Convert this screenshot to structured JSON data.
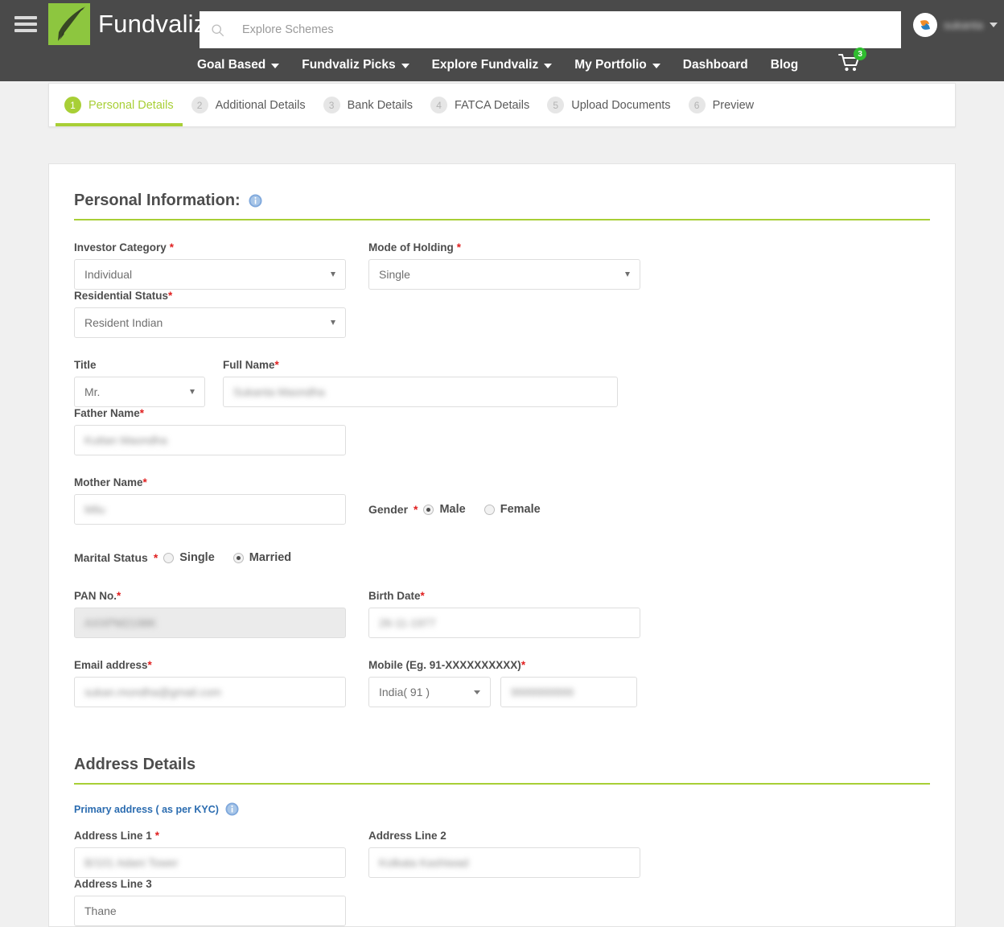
{
  "header": {
    "menu_icon": "hamburger-icon",
    "brand": "Fundvaliz",
    "search": {
      "placeholder": "Explore Schemes",
      "value": "",
      "icon": "search-icon"
    },
    "user": {
      "name": "sukanta",
      "avatar_icon": "user-avatar-icon",
      "caret_icon": "chevron-down-icon"
    }
  },
  "nav": {
    "items": [
      {
        "label": "Goal Based",
        "has_dropdown": true
      },
      {
        "label": "Fundvaliz Picks",
        "has_dropdown": true
      },
      {
        "label": "Explore Fundvaliz",
        "has_dropdown": true
      },
      {
        "label": "My Portfolio",
        "has_dropdown": true
      },
      {
        "label": "Dashboard",
        "has_dropdown": false
      },
      {
        "label": "Blog",
        "has_dropdown": false
      }
    ],
    "cart": {
      "icon": "shopping-cart-icon",
      "badge": "3"
    }
  },
  "wizard": {
    "steps": [
      {
        "num": "1",
        "label": "Personal Details",
        "active": true
      },
      {
        "num": "2",
        "label": "Additional Details",
        "active": false
      },
      {
        "num": "3",
        "label": "Bank Details",
        "active": false
      },
      {
        "num": "4",
        "label": "FATCA Details",
        "active": false
      },
      {
        "num": "5",
        "label": "Upload Documents",
        "active": false
      },
      {
        "num": "6",
        "label": "Preview",
        "active": false
      }
    ]
  },
  "personal": {
    "title": "Personal Information:",
    "info_icon": "info-icon",
    "investor_category": {
      "label": "Investor Category",
      "required": true,
      "value": "Individual"
    },
    "mode_of_holding": {
      "label": "Mode of Holding",
      "required": true,
      "value": "Single"
    },
    "residential_status": {
      "label": "Residential Status",
      "required": true,
      "value": "Resident Indian"
    },
    "title_field": {
      "label": "Title",
      "required": false,
      "value": "Mr."
    },
    "full_name": {
      "label": "Full Name",
      "required": true,
      "value": "Sukanta Maondha",
      "redacted": true
    },
    "father_name": {
      "label": "Father Name",
      "required": true,
      "value": "Kuttan Maondha",
      "redacted": true
    },
    "mother_name": {
      "label": "Mother Name",
      "required": true,
      "value": "Milu",
      "redacted": true
    },
    "gender": {
      "label": "Gender",
      "required": true,
      "selected": "Male",
      "options": [
        {
          "label": "Male",
          "selected": true
        },
        {
          "label": "Female",
          "selected": false
        }
      ]
    },
    "marital_status": {
      "label": "Marital Status",
      "required": true,
      "selected": "Married",
      "options": [
        {
          "label": "Single",
          "selected": false
        },
        {
          "label": "Married",
          "selected": true
        }
      ]
    },
    "pan_no": {
      "label": "PAN No.",
      "required": true,
      "value": "AXXPM2198K",
      "redacted": true,
      "disabled": true
    },
    "birth_date": {
      "label": "Birth Date",
      "required": true,
      "value": "26-11-1977",
      "redacted": true
    },
    "email": {
      "label": "Email address",
      "required": true,
      "value": "sukan.mondha@gmail.com",
      "redacted": true
    },
    "mobile": {
      "label": "Mobile (Eg. 91-XXXXXXXXXX)",
      "required": true,
      "country_code": "India( 91 )",
      "number": "9999999999",
      "redacted": true
    }
  },
  "address": {
    "title": "Address Details",
    "primary_label": "Primary address ( as per KYC)",
    "info_icon": "info-icon",
    "line1": {
      "label": "Address Line 1",
      "required": true,
      "value": "B/101 Adani Tower",
      "redacted": true
    },
    "line2": {
      "label": "Address Line 2",
      "required": false,
      "value": "Kolkata Kashiwad",
      "redacted": true
    },
    "line3": {
      "label": "Address Line 3",
      "required": false,
      "value": "Thane",
      "redacted": false
    }
  },
  "colors": {
    "accent_green": "#a8cf36",
    "header_gray": "#4a4a4a",
    "logo_green": "#8dc63f",
    "required_red": "#e02020",
    "link_blue": "#2b6cb0",
    "badge_green": "#2fbd2f",
    "page_bg": "#f0f0f0"
  }
}
